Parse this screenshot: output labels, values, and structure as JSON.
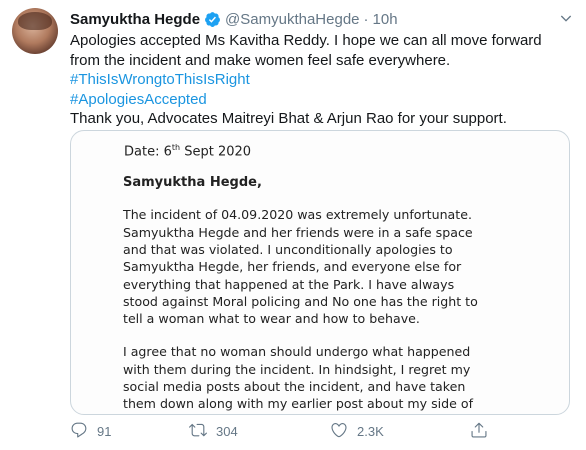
{
  "author": {
    "name": "Samyuktha Hegde",
    "handle": "@SamyukthaHegde",
    "separator": "·",
    "time": "10h"
  },
  "tweet": {
    "line1": "Apologies accepted Ms Kavitha Reddy. I hope we can all move forward",
    "line2": "from the incident and make women feel safe everywhere.",
    "hashtag1": "#ThisIsWrongtoThisIsRight",
    "hashtag2": "#ApologiesAccepted",
    "line3": "Thank you, Advocates Maitreyi Bhat & Arjun Rao for your support."
  },
  "letter": {
    "date_prefix": "Date: 6",
    "date_sup": "th",
    "date_suffix": " Sept 2020",
    "salutation": "Samyuktha Hegde,",
    "para1": [
      "The incident of 04.09.2020 was extremely unfortunate.",
      "Samyuktha Hegde and her friends were in a safe space",
      "and that was violated. I unconditionally apologies to",
      "Samyuktha Hegde, her friends, and everyone else for",
      "everything that happened at the Park. I have always",
      "stood against Moral policing and No one has the right to",
      "tell a woman what to wear and how to behave."
    ],
    "para2": [
      "I agree that no woman should undergo what happened",
      "with them during the incident. In hindsight, I regret my",
      "social media posts about the incident, and have taken",
      "them down along with my earlier post about my side of"
    ]
  },
  "actions": {
    "reply_count": "91",
    "retweet_count": "304",
    "like_count": "2.3K"
  },
  "colors": {
    "verified": "#1da1f2",
    "hashtag": "#1b95e0",
    "muted": "#657786"
  }
}
